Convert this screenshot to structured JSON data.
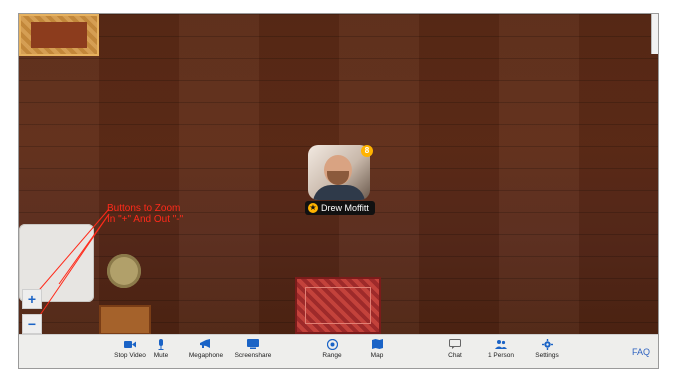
{
  "annotation": {
    "line1": "Buttons to Zoom",
    "line2": "In \"+\" And Out \"-\""
  },
  "zoom": {
    "in_label": "+",
    "out_label": "−"
  },
  "participant": {
    "name": "Drew Moffitt",
    "badge": "8"
  },
  "toolbar": {
    "items": [
      {
        "label": "Stop Video",
        "icon": "video-camera-icon"
      },
      {
        "label": "Mute",
        "icon": "microphone-icon"
      },
      {
        "label": "Megaphone",
        "icon": "megaphone-icon"
      },
      {
        "label": "Screenshare",
        "icon": "screenshare-icon"
      },
      {
        "label": "Range",
        "icon": "range-icon"
      },
      {
        "label": "Map",
        "icon": "map-icon"
      },
      {
        "label": "Chat",
        "icon": "chat-icon"
      },
      {
        "label": "1 Person",
        "icon": "people-icon"
      },
      {
        "label": "Settings",
        "icon": "gear-icon"
      }
    ],
    "faq_label": "FAQ"
  },
  "colors": {
    "accent": "#1a63c6",
    "annotation": "#ff2a1a",
    "badge": "#ffb300",
    "floor": "#5a2a16"
  }
}
